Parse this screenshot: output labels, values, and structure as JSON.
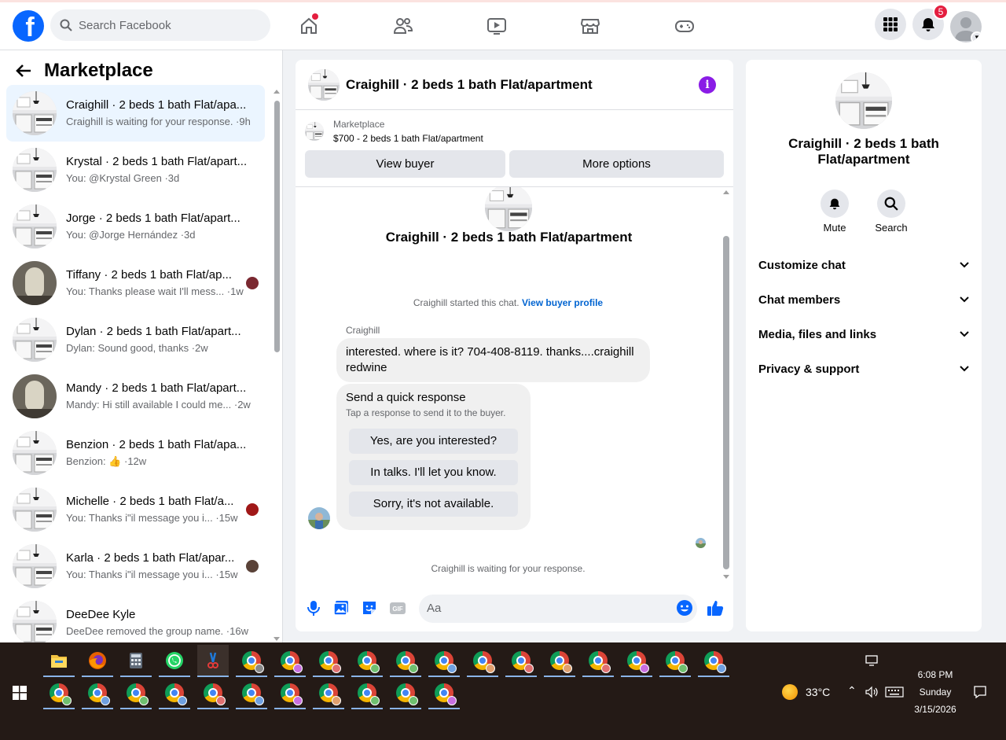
{
  "topbar": {
    "search_placeholder": "Search Facebook",
    "notifications_count": "5",
    "nav_icons": [
      "home-icon",
      "friends-icon",
      "video-icon",
      "marketplace-icon",
      "gaming-icon"
    ]
  },
  "left": {
    "title": "Marketplace",
    "conversations": [
      {
        "title": "Craighill · 2 beds 1 bath Flat/apa...",
        "sub": "Craighill is waiting for your response. ·9h",
        "active": true,
        "mini": null
      },
      {
        "title": "Krystal · 2 beds 1 bath Flat/apart...",
        "sub": "You: @Krystal Green ·3d",
        "mini": null
      },
      {
        "title": "Jorge · 2 beds 1 bath Flat/apart...",
        "sub": "You: @Jorge Hernández ·3d",
        "mini": null
      },
      {
        "title": "Tiffany · 2 beds 1 bath Flat/ap...",
        "sub": "You: Thanks please wait I'll mess... ·1w",
        "mini": "#7a2830"
      },
      {
        "title": "Dylan · 2 beds 1 bath Flat/apart...",
        "sub": "Dylan: Sound good, thanks ·2w",
        "mini": null
      },
      {
        "title": "Mandy · 2 beds 1 bath Flat/apart...",
        "sub": "Mandy: Hi still available I could me... ·2w",
        "mini": null
      },
      {
        "title": "Benzion · 2 beds 1 bath Flat/apa...",
        "sub": "Benzion: 👍 ·12w",
        "mini": null
      },
      {
        "title": "Michelle · 2 beds 1 bath Flat/a...",
        "sub": "You: Thanks i\"il message you i... ·15w",
        "mini": "#a01818"
      },
      {
        "title": "Karla · 2 beds 1 bath Flat/apar...",
        "sub": "You: Thanks i\"il message you i... ·15w",
        "mini": "#5a4238"
      },
      {
        "title": "DeeDee Kyle",
        "sub": "DeeDee removed the group name. ·16w",
        "mini": null
      }
    ]
  },
  "chat": {
    "title": "Craighill · 2 beds 1 bath Flat/apartment",
    "marketplace_label": "Marketplace",
    "listing": "$700 - 2 beds 1 bath Flat/apartment",
    "view_buyer": "View buyer",
    "more_options": "More options",
    "center_title": "Craighill · 2 beds 1 bath Flat/apartment",
    "started_text": "Craighill started this chat.",
    "view_buyer_profile": "View buyer profile",
    "sender": "Craighill",
    "message": "interested.  where is it?  704-408-8119.  thanks....craighill redwine",
    "quick_title": "Send a quick response",
    "quick_sub": "Tap a response to send it to the buyer.",
    "quick_replies": [
      "Yes, are you interested?",
      "In talks. I'll let you know.",
      "Sorry, it's not available."
    ],
    "waiting": "Craighill is waiting for your response.",
    "composer_placeholder": "Aa"
  },
  "right": {
    "title": "Craighill · 2 beds 1 bath Flat/apartment",
    "mute": "Mute",
    "search": "Search",
    "sections": [
      "Customize chat",
      "Chat members",
      "Media, files and links",
      "Privacy & support"
    ]
  },
  "taskbar": {
    "temperature": "33°C",
    "time": "6:08 PM",
    "day": "Sunday",
    "date": "3/15/2026",
    "profile_colors_row1": [
      "#888",
      "#c86fe0",
      "#e07070",
      "#6fbf6f",
      "#6fbf6f",
      "#6fa0e0",
      "#e0a06f",
      "#e07070",
      "#e0a06f",
      "#e07070",
      "#c86fe0",
      "#6fbf6f",
      "#6fa0e0"
    ],
    "profile_colors_row2": [
      "#6fbf6f",
      "#6fa0e0",
      "#6fbf6f",
      "#6fa0e0",
      "#e07070",
      "#6fa0e0",
      "#c86fe0",
      "#e0a06f",
      "#6fbf6f",
      "#6fbf6f",
      "#c86fe0"
    ]
  },
  "colors": {
    "accent": "#0866ff",
    "info": "#8a1ce6",
    "notification": "#e41e3f"
  }
}
